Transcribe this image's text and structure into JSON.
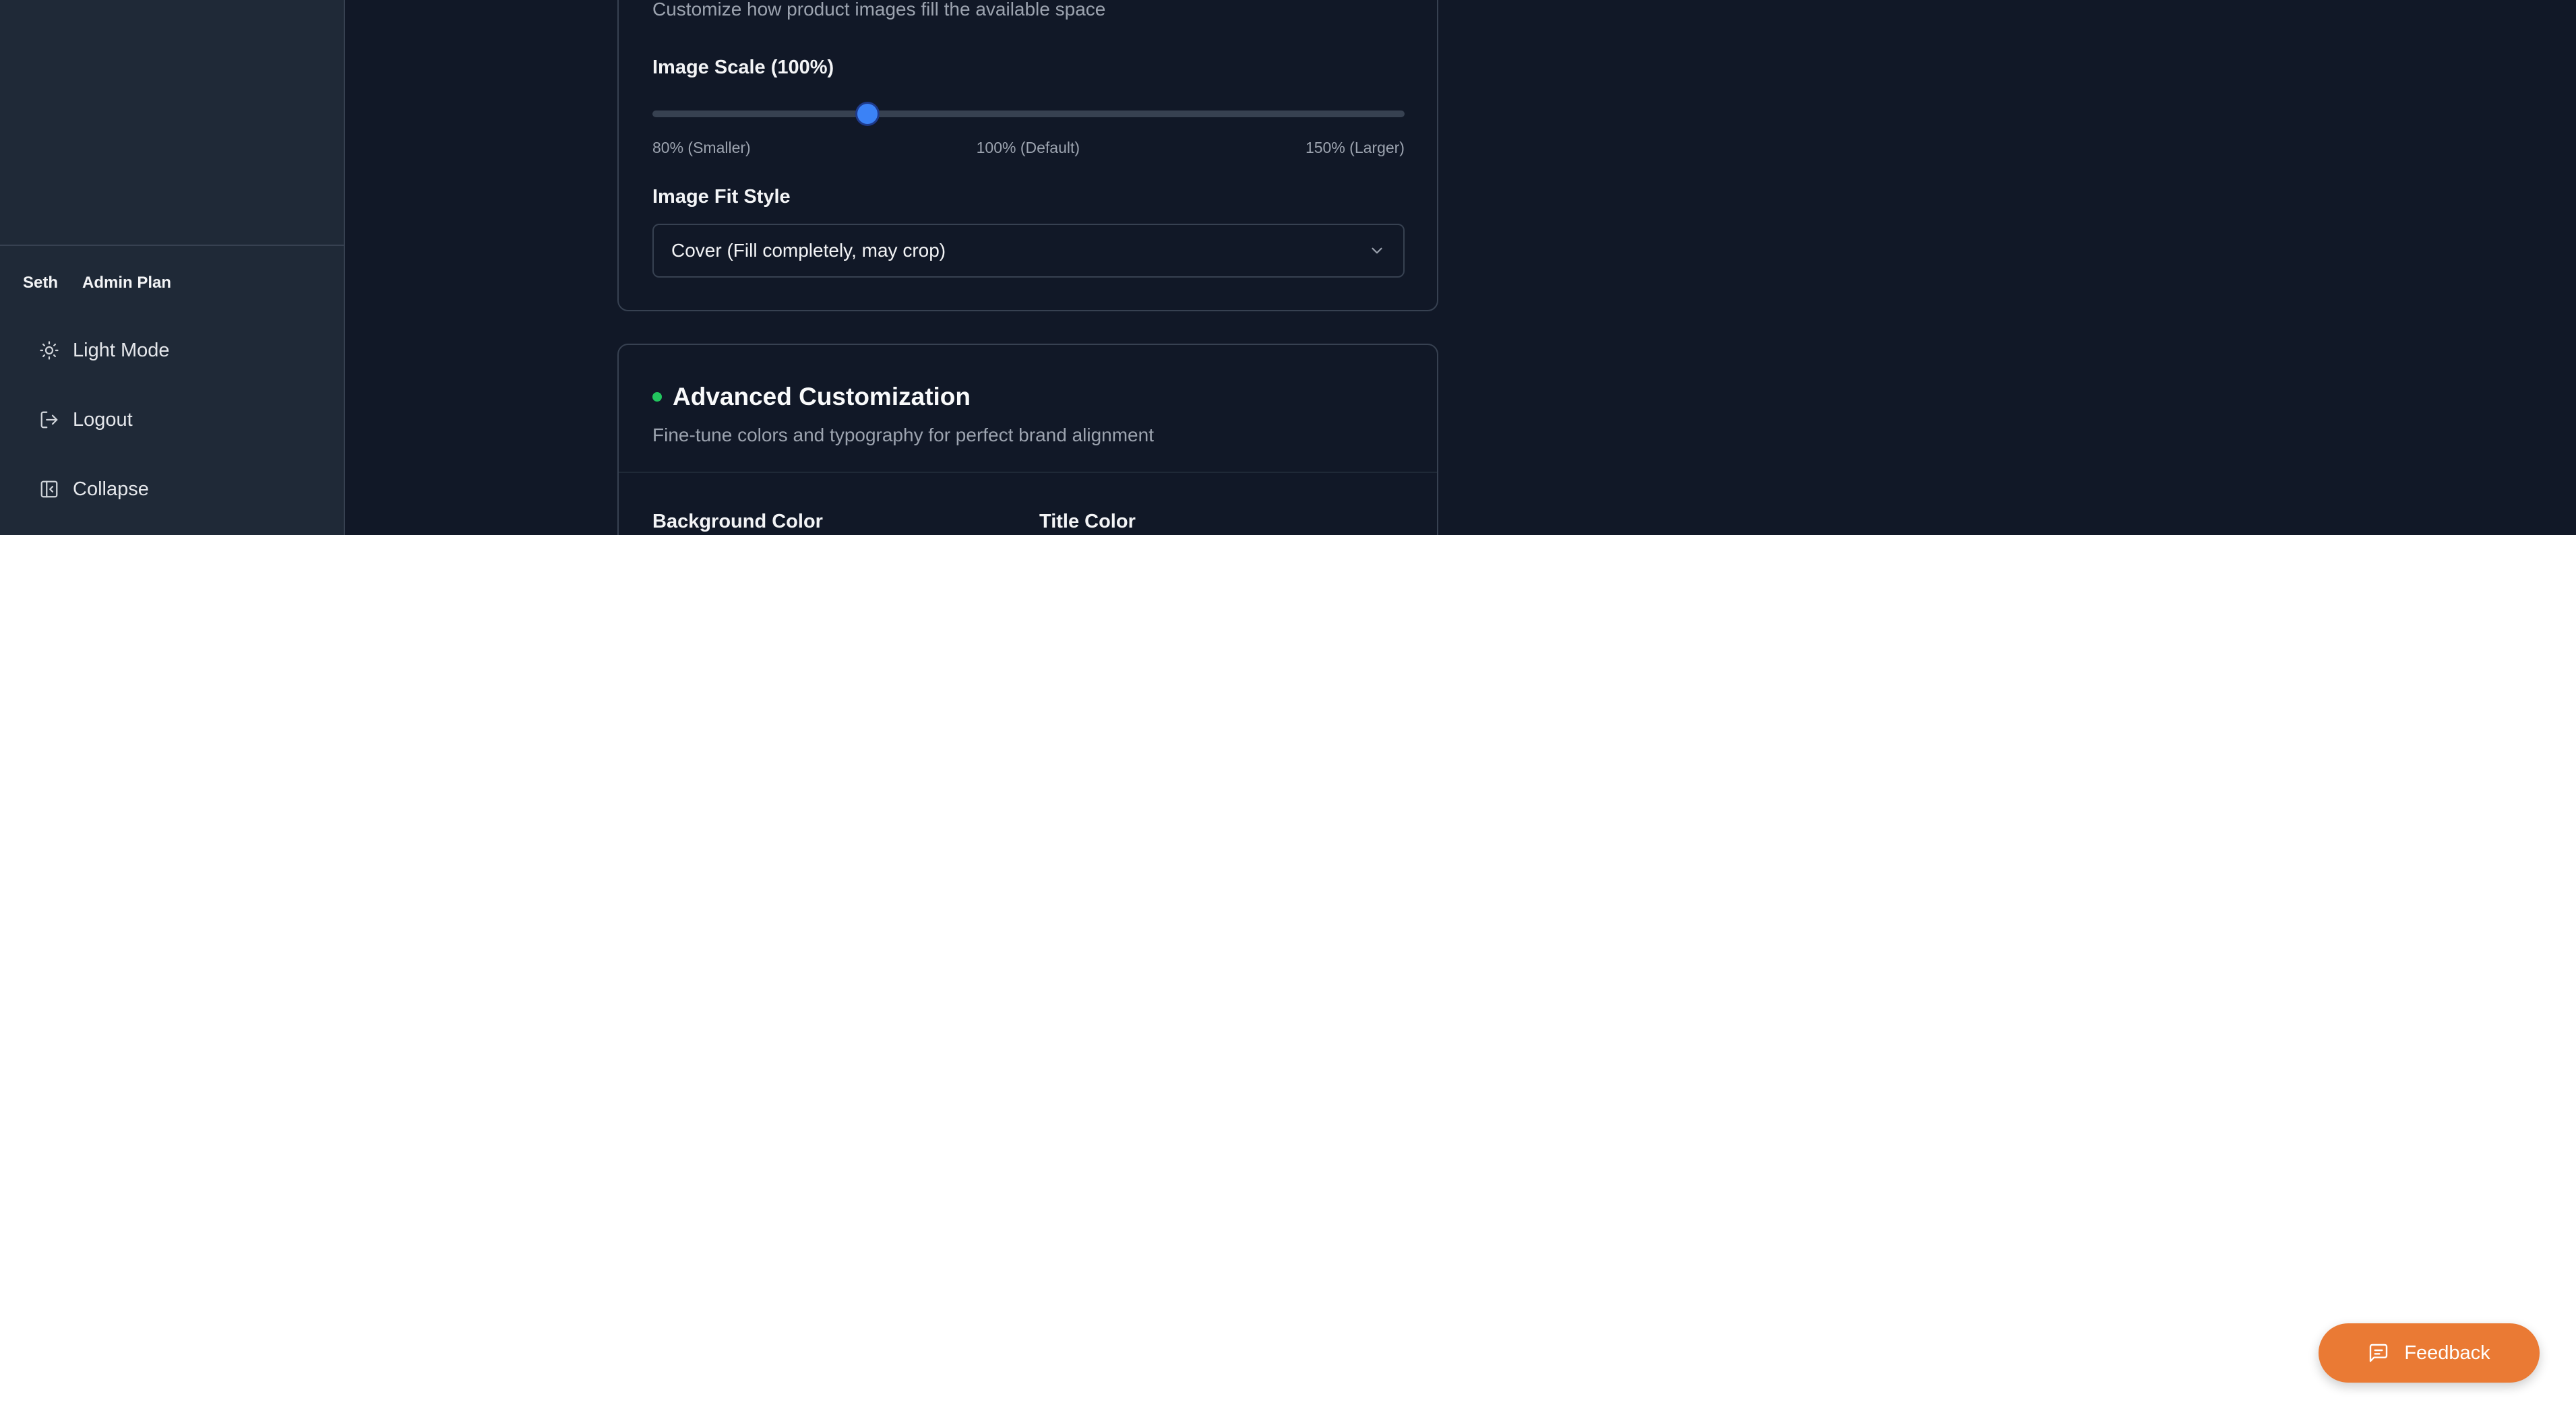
{
  "sidebar": {
    "user_name": "Seth",
    "plan": "Admin Plan",
    "items": [
      {
        "label": "Light Mode",
        "icon": "sun-icon"
      },
      {
        "label": "Logout",
        "icon": "logout-icon"
      },
      {
        "label": "Collapse",
        "icon": "collapse-panel-icon"
      }
    ]
  },
  "image_settings": {
    "description": "Customize how product images fill the available space",
    "scale_label": "Image Scale (100%)",
    "scale_value_percent": 100,
    "scale_range": [
      80,
      150
    ],
    "scale_min_label": "80% (Smaller)",
    "scale_default_label": "100% (Default)",
    "scale_max_label": "150% (Larger)",
    "fit_label": "Image Fit Style",
    "fit_value": "Cover (Fill completely, may crop)"
  },
  "advanced": {
    "title": "Advanced Customization",
    "description": "Fine-tune colors and typography for perfect brand alignment",
    "background_color_label": "Background Color",
    "title_color_label": "Title Color"
  },
  "feedback": {
    "label": "Feedback"
  },
  "colors": {
    "background": "#111827",
    "sidebar": "#1f2937",
    "accent": "#3b82f6",
    "status_dot": "#22c55e",
    "feedback_button": "#ea7a34"
  }
}
